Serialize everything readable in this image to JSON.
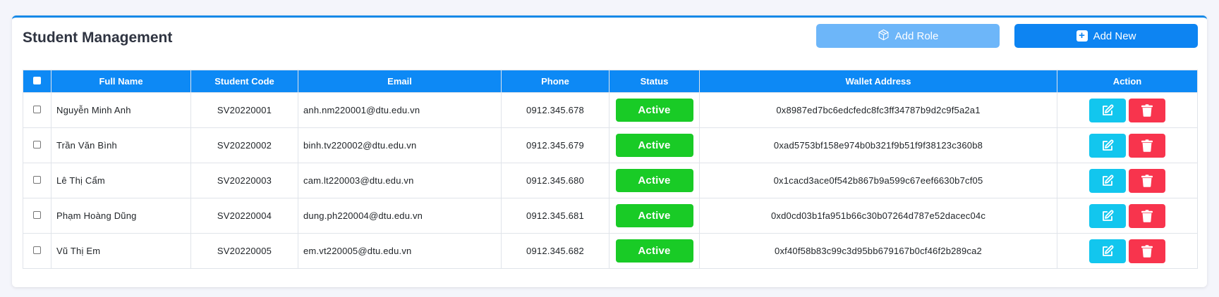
{
  "page": {
    "title": "Student Management",
    "add_role_label": "Add Role",
    "add_new_label": "Add New"
  },
  "colors": {
    "accent": "#0d89f5",
    "add_role_bg": "#6db6f9",
    "status_active": "#19cb26",
    "edit_button": "#12c6ee",
    "delete_button": "#f8344d"
  },
  "icons": {
    "add_role": "cube-icon",
    "add_new": "plus-square-icon",
    "edit": "edit-icon",
    "delete": "trash-icon"
  },
  "table": {
    "headers": {
      "full_name": "Full Name",
      "student_code": "Student Code",
      "email": "Email",
      "phone": "Phone",
      "status": "Status",
      "wallet": "Wallet Address",
      "action": "Action"
    },
    "rows": [
      {
        "name": "Nguyễn Minh Anh",
        "code": "SV20220001",
        "email": "anh.nm220001@dtu.edu.vn",
        "phone": "0912.345.678",
        "status": "Active",
        "wallet": "0x8987ed7bc6edcfedc8fc3ff34787b9d2c9f5a2a1"
      },
      {
        "name": "Trần Văn Bình",
        "code": "SV20220002",
        "email": "binh.tv220002@dtu.edu.vn",
        "phone": "0912.345.679",
        "status": "Active",
        "wallet": "0xad5753bf158e974b0b321f9b51f9f38123c360b8"
      },
      {
        "name": "Lê Thị Cẩm",
        "code": "SV20220003",
        "email": "cam.lt220003@dtu.edu.vn",
        "phone": "0912.345.680",
        "status": "Active",
        "wallet": "0x1cacd3ace0f542b867b9a599c67eef6630b7cf05"
      },
      {
        "name": "Phạm Hoàng Dũng",
        "code": "SV20220004",
        "email": "dung.ph220004@dtu.edu.vn",
        "phone": "0912.345.681",
        "status": "Active",
        "wallet": "0xd0cd03b1fa951b66c30b07264d787e52dacec04c"
      },
      {
        "name": "Vũ Thị Em",
        "code": "SV20220005",
        "email": "em.vt220005@dtu.edu.vn",
        "phone": "0912.345.682",
        "status": "Active",
        "wallet": "0xf40f58b83c99c3d95bb679167b0cf46f2b289ca2"
      }
    ]
  }
}
